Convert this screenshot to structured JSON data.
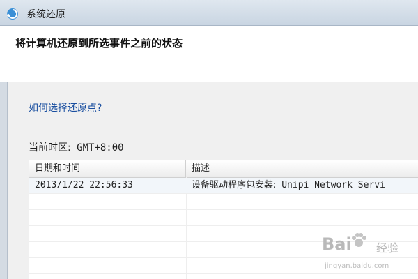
{
  "window": {
    "title": "系统还原",
    "header": "将计算机还原到所选事件之前的状态"
  },
  "help_link": "如何选择还原点?",
  "timezone": {
    "label": "当前时区:",
    "value": "GMT+8:00"
  },
  "table": {
    "columns": [
      "日期和时间",
      "描述"
    ],
    "rows": [
      {
        "date": "2013/1/22 22:56:33",
        "desc_prefix": "设备驱动程序包安装:",
        "desc_rest": " Unipi Network Servi"
      }
    ]
  },
  "watermark": {
    "brand_left": "Bai",
    "brand_right": "经验",
    "url": "jingyan.baidu.com"
  }
}
